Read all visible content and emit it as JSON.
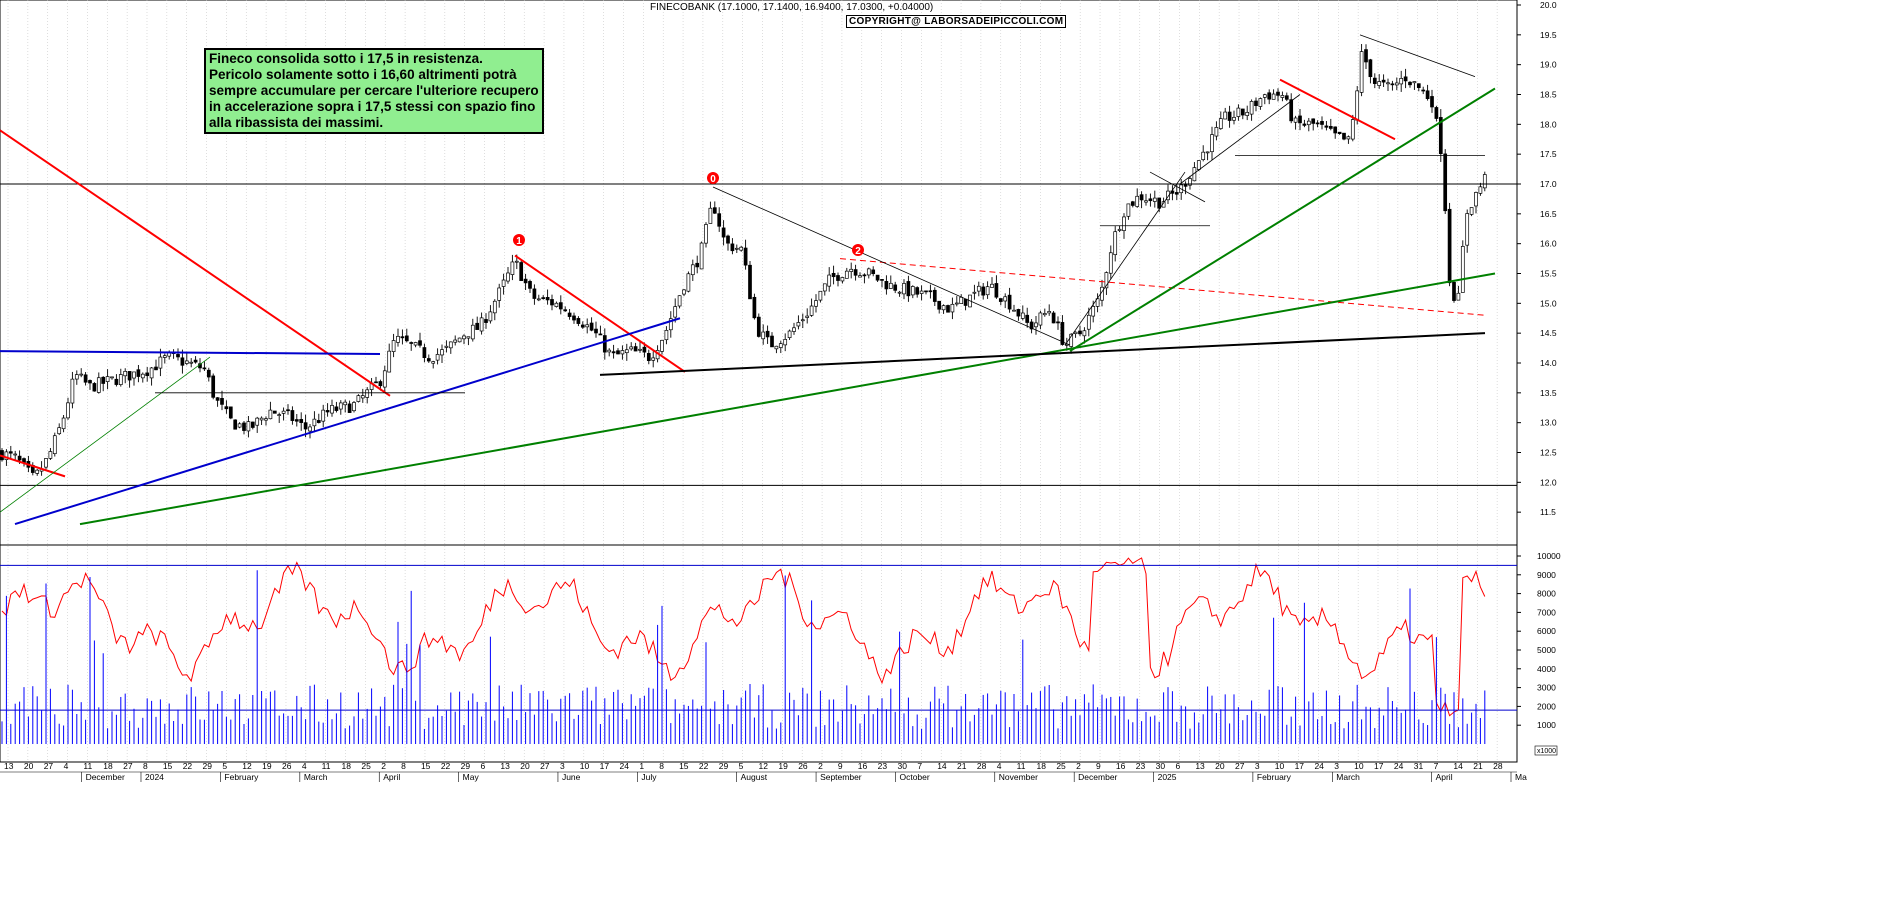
{
  "header": {
    "ticker_line": "FINECOBANK (17.1000, 17.1400, 16.9400, 17.0300, +0.04000)",
    "copyright": "COPYRIGHT@ LABORSADEIPICCOLI.COM"
  },
  "annotation": {
    "lines": [
      "Fineco consolida sotto i 17,5 in resistenza.",
      "Pericolo solamente sotto i 16,60 altrimenti potrà",
      "sempre accumulare per cercare l'ulteriore recupero",
      "in accelerazione sopra i 17,5 stessi con spazio fino",
      "alla ribassista dei massimi."
    ]
  },
  "markers": [
    "1",
    "0",
    "2"
  ],
  "colors": {
    "candles": "#000000",
    "support_green": "#008000",
    "resistance_red": "#ff0000",
    "trend_blue": "#0000cc",
    "horizontal": "#000000",
    "oscillator": "#ff0000",
    "volume": "#0000ff",
    "annotation_bg": "#90ee90"
  },
  "chart_data": [
    {
      "type": "candlestick",
      "title": "FINECOBANK",
      "ylim": [
        11.0,
        20.0
      ],
      "y_ticks": [
        "20.0",
        "19.5",
        "19.0",
        "18.5",
        "18.0",
        "17.5",
        "17.0",
        "16.5",
        "16.0",
        "15.5",
        "15.0",
        "14.5",
        "14.0",
        "13.5",
        "13.0",
        "12.5",
        "12.0",
        "11.5"
      ],
      "y_tick_values": [
        20.0,
        19.5,
        19.0,
        18.5,
        18.0,
        17.5,
        17.0,
        16.5,
        16.0,
        15.5,
        15.0,
        14.5,
        14.0,
        13.5,
        13.0,
        12.5,
        12.0,
        11.5
      ],
      "horizontal_levels": [
        17.0,
        11.95
      ],
      "anchors": [
        {
          "x": 0,
          "price": 12.5
        },
        {
          "x": 16,
          "price": 12.4
        },
        {
          "x": 34,
          "price": 12.05
        },
        {
          "x": 48,
          "price": 12.4
        },
        {
          "x": 62,
          "price": 13.0
        },
        {
          "x": 75,
          "price": 13.8
        },
        {
          "x": 90,
          "price": 13.6
        },
        {
          "x": 110,
          "price": 13.7
        },
        {
          "x": 130,
          "price": 13.8
        },
        {
          "x": 150,
          "price": 13.9
        },
        {
          "x": 168,
          "price": 14.1
        },
        {
          "x": 188,
          "price": 14.0
        },
        {
          "x": 205,
          "price": 13.9
        },
        {
          "x": 215,
          "price": 13.4
        },
        {
          "x": 232,
          "price": 13.0
        },
        {
          "x": 250,
          "price": 12.9
        },
        {
          "x": 270,
          "price": 13.2
        },
        {
          "x": 290,
          "price": 13.1
        },
        {
          "x": 305,
          "price": 12.9
        },
        {
          "x": 330,
          "price": 13.2
        },
        {
          "x": 355,
          "price": 13.3
        },
        {
          "x": 380,
          "price": 13.7
        },
        {
          "x": 395,
          "price": 14.4
        },
        {
          "x": 410,
          "price": 14.3
        },
        {
          "x": 430,
          "price": 14.1
        },
        {
          "x": 445,
          "price": 14.2
        },
        {
          "x": 465,
          "price": 14.5
        },
        {
          "x": 480,
          "price": 14.6
        },
        {
          "x": 500,
          "price": 15.2
        },
        {
          "x": 515,
          "price": 15.7
        },
        {
          "x": 532,
          "price": 15.1
        },
        {
          "x": 555,
          "price": 15.0
        },
        {
          "x": 575,
          "price": 14.8
        },
        {
          "x": 595,
          "price": 14.5
        },
        {
          "x": 612,
          "price": 14.1
        },
        {
          "x": 630,
          "price": 14.2
        },
        {
          "x": 650,
          "price": 14.1
        },
        {
          "x": 665,
          "price": 14.5
        },
        {
          "x": 683,
          "price": 15.3
        },
        {
          "x": 700,
          "price": 15.8
        },
        {
          "x": 713,
          "price": 16.7
        },
        {
          "x": 725,
          "price": 16.0
        },
        {
          "x": 742,
          "price": 15.9
        },
        {
          "x": 756,
          "price": 14.6
        },
        {
          "x": 770,
          "price": 14.3
        },
        {
          "x": 790,
          "price": 14.5
        },
        {
          "x": 810,
          "price": 14.9
        },
        {
          "x": 830,
          "price": 15.4
        },
        {
          "x": 850,
          "price": 15.6
        },
        {
          "x": 868,
          "price": 15.5
        },
        {
          "x": 890,
          "price": 15.3
        },
        {
          "x": 910,
          "price": 15.2
        },
        {
          "x": 930,
          "price": 15.1
        },
        {
          "x": 950,
          "price": 14.9
        },
        {
          "x": 970,
          "price": 15.1
        },
        {
          "x": 990,
          "price": 15.3
        },
        {
          "x": 1010,
          "price": 15.0
        },
        {
          "x": 1030,
          "price": 14.6
        },
        {
          "x": 1050,
          "price": 14.9
        },
        {
          "x": 1065,
          "price": 14.3
        },
        {
          "x": 1080,
          "price": 14.5
        },
        {
          "x": 1100,
          "price": 15.1
        },
        {
          "x": 1112,
          "price": 16.0
        },
        {
          "x": 1125,
          "price": 16.6
        },
        {
          "x": 1140,
          "price": 16.8
        },
        {
          "x": 1160,
          "price": 16.7
        },
        {
          "x": 1180,
          "price": 16.9
        },
        {
          "x": 1195,
          "price": 17.3
        },
        {
          "x": 1210,
          "price": 17.7
        },
        {
          "x": 1225,
          "price": 18.1
        },
        {
          "x": 1245,
          "price": 18.2
        },
        {
          "x": 1265,
          "price": 18.5
        },
        {
          "x": 1282,
          "price": 18.5
        },
        {
          "x": 1295,
          "price": 18.0
        },
        {
          "x": 1315,
          "price": 18.0
        },
        {
          "x": 1335,
          "price": 17.8
        },
        {
          "x": 1350,
          "price": 17.7
        },
        {
          "x": 1362,
          "price": 19.2
        },
        {
          "x": 1375,
          "price": 18.7
        },
        {
          "x": 1390,
          "price": 18.6
        },
        {
          "x": 1405,
          "price": 18.8
        },
        {
          "x": 1420,
          "price": 18.6
        },
        {
          "x": 1432,
          "price": 18.4
        },
        {
          "x": 1442,
          "price": 17.5
        },
        {
          "x": 1450,
          "price": 15.3
        },
        {
          "x": 1458,
          "price": 15.0
        },
        {
          "x": 1466,
          "price": 16.5
        },
        {
          "x": 1475,
          "price": 16.8
        },
        {
          "x": 1485,
          "price": 17.1
        }
      ],
      "trendlines": [
        {
          "color": "red",
          "points": [
            [
              0,
              17.9
            ],
            [
              390,
              13.45
            ]
          ]
        },
        {
          "color": "red",
          "points": [
            [
              515,
              15.8
            ],
            [
              685,
              13.85
            ]
          ]
        },
        {
          "color": "red",
          "points": [
            [
              1280,
              18.75
            ],
            [
              1395,
              17.75
            ]
          ]
        },
        {
          "color": "red",
          "dashed": true,
          "points": [
            [
              840,
              15.75
            ],
            [
              1485,
              14.8
            ]
          ]
        },
        {
          "color": "red",
          "points": [
            [
              0,
              12.45
            ],
            [
              65,
              12.1
            ]
          ]
        },
        {
          "color": "blue",
          "points": [
            [
              15,
              11.3
            ],
            [
              680,
              14.75
            ]
          ]
        },
        {
          "color": "blue",
          "points": [
            [
              0,
              14.2
            ],
            [
              380,
              14.15
            ]
          ]
        },
        {
          "color": "green",
          "points": [
            [
              80,
              11.3
            ],
            [
              1495,
              15.5
            ]
          ]
        },
        {
          "color": "green",
          "points": [
            [
              1070,
              14.2
            ],
            [
              1495,
              18.6
            ]
          ]
        },
        {
          "color": "green",
          "thin": true,
          "points": [
            [
              0,
              11.5
            ],
            [
              210,
              14.1
            ]
          ]
        },
        {
          "color": "black",
          "points": [
            [
              600,
              13.8
            ],
            [
              1485,
              14.5
            ]
          ]
        },
        {
          "color": "black",
          "thin": true,
          "points": [
            [
              713,
              16.95
            ],
            [
              1070,
              14.3
            ]
          ]
        },
        {
          "color": "black",
          "thin": true,
          "points": [
            [
              1360,
              19.5
            ],
            [
              1475,
              18.8
            ]
          ]
        },
        {
          "color": "black",
          "thin": true,
          "points": [
            [
              1065,
              14.3
            ],
            [
              1185,
              17.2
            ]
          ]
        },
        {
          "color": "black",
          "thin": true,
          "points": [
            [
              1180,
              17.0
            ],
            [
              1300,
              18.5
            ]
          ]
        },
        {
          "color": "black",
          "thin": true,
          "points": [
            [
              1150,
              17.2
            ],
            [
              1205,
              16.7
            ]
          ]
        },
        {
          "color": "black",
          "thin": true,
          "points": [
            [
              155,
              13.5
            ],
            [
              465,
              13.5
            ]
          ]
        },
        {
          "color": "black",
          "thin": true,
          "points": [
            [
              1100,
              16.3
            ],
            [
              1210,
              16.3
            ]
          ]
        },
        {
          "color": "black",
          "thin": true,
          "points": [
            [
              1235,
              17.48
            ],
            [
              1485,
              17.48
            ]
          ]
        }
      ]
    },
    {
      "type": "area",
      "title": "volume",
      "ylim": [
        0,
        10000
      ],
      "y_ticks": [
        "10000",
        "9000",
        "8000",
        "7000",
        "6000",
        "5000",
        "4000",
        "3000",
        "2000",
        "1000"
      ],
      "y_tick_values": [
        10000,
        9000,
        8000,
        7000,
        6000,
        5000,
        4000,
        3000,
        2000,
        1000
      ],
      "scale_label": "x1000",
      "horizontal_levels": [
        9500,
        1800
      ]
    }
  ],
  "x_axis": {
    "day_labels": [
      "13",
      "20",
      "27",
      "4",
      "11",
      "18",
      "27",
      "8",
      "15",
      "22",
      "29",
      "5",
      "12",
      "19",
      "26",
      "4",
      "11",
      "18",
      "25",
      "2",
      "8",
      "15",
      "22",
      "29",
      "6",
      "13",
      "20",
      "27",
      "3",
      "10",
      "17",
      "24",
      "1",
      "8",
      "15",
      "22",
      "29",
      "5",
      "12",
      "19",
      "26",
      "2",
      "9",
      "16",
      "23",
      "30",
      "7",
      "14",
      "21",
      "28",
      "4",
      "11",
      "18",
      "25",
      "2",
      "9",
      "16",
      "23",
      "30",
      "6",
      "13",
      "20",
      "27",
      "3",
      "10",
      "17",
      "24",
      "3",
      "10",
      "17",
      "24",
      "31",
      "7",
      "14",
      "21",
      "28"
    ],
    "month_labels": [
      "December",
      "2024",
      "February",
      "March",
      "April",
      "May",
      "June",
      "July",
      "August",
      "September",
      "October",
      "November",
      "December",
      "2025",
      "February",
      "March",
      "April",
      "Ma"
    ]
  }
}
